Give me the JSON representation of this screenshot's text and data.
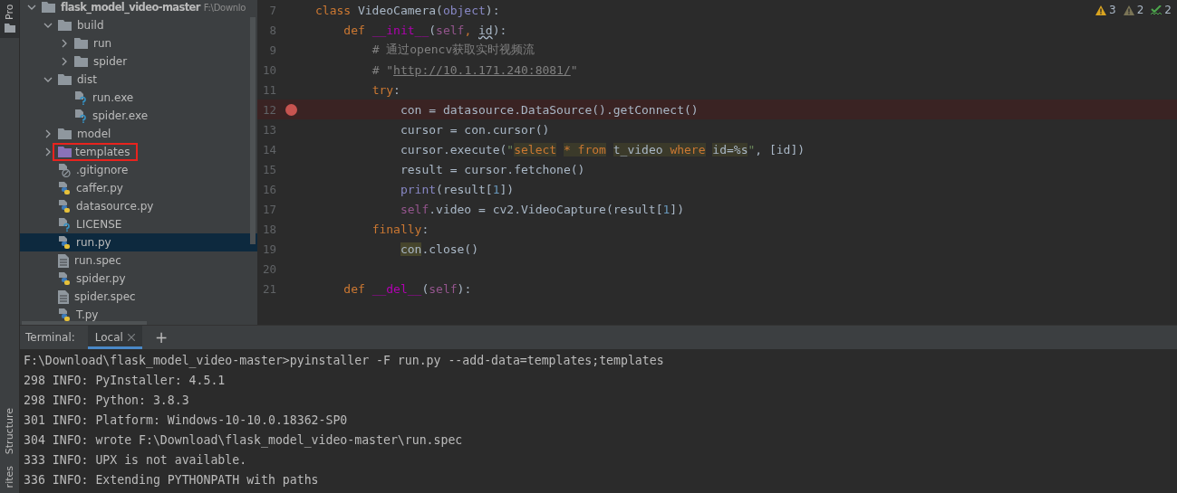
{
  "tool_strip": {
    "top": [
      {
        "label": "Pro",
        "selected": true
      }
    ],
    "bottom": [
      {
        "label": "Structure",
        "selected": false
      },
      {
        "label": "rites",
        "selected": false
      }
    ]
  },
  "project_tree": {
    "items": [
      {
        "label": "flask_model_video-master",
        "hint": "F:\\Downlo",
        "kind": "folder",
        "expanded": true,
        "selected": false,
        "marked": false,
        "children": [
          {
            "label": "build",
            "kind": "folder",
            "expanded": true,
            "selected": false,
            "marked": false,
            "children": [
              {
                "label": "run",
                "kind": "folder",
                "expanded": false,
                "selected": false,
                "marked": false
              },
              {
                "label": "spider",
                "kind": "folder",
                "expanded": false,
                "selected": false,
                "marked": false
              }
            ]
          },
          {
            "label": "dist",
            "kind": "folder",
            "expanded": true,
            "selected": false,
            "marked": false,
            "children": [
              {
                "label": "run.exe",
                "kind": "unknown",
                "selected": false,
                "marked": false
              },
              {
                "label": "spider.exe",
                "kind": "unknown",
                "selected": false,
                "marked": false
              }
            ]
          },
          {
            "label": "model",
            "kind": "folder",
            "expanded": false,
            "selected": false,
            "marked": false
          },
          {
            "label": "templates",
            "kind": "template-folder",
            "expanded": false,
            "selected": false,
            "marked": true
          },
          {
            "label": ".gitignore",
            "kind": "ignored",
            "selected": false,
            "marked": false
          },
          {
            "label": "caffer.py",
            "kind": "python",
            "selected": false,
            "marked": false
          },
          {
            "label": "datasource.py",
            "kind": "python",
            "selected": false,
            "marked": false
          },
          {
            "label": "LICENSE",
            "kind": "unknown",
            "selected": false,
            "marked": false
          },
          {
            "label": "run.py",
            "kind": "python",
            "selected": true,
            "marked": false
          },
          {
            "label": "run.spec",
            "kind": "text",
            "selected": false,
            "marked": false
          },
          {
            "label": "spider.py",
            "kind": "python",
            "selected": false,
            "marked": false
          },
          {
            "label": "spider.spec",
            "kind": "text",
            "selected": false,
            "marked": false
          },
          {
            "label": "T.py",
            "kind": "python",
            "selected": false,
            "marked": false
          }
        ]
      }
    ]
  },
  "inspections": [
    {
      "kind": "warning",
      "count": "3"
    },
    {
      "kind": "weak-warning",
      "count": "2"
    },
    {
      "kind": "typo",
      "count": "2"
    }
  ],
  "editor": {
    "lines": [
      {
        "number": "7",
        "breakpoint": false,
        "tokens": [
          {
            "text": "class",
            "kind": "kw"
          },
          {
            "text": " VideoCamera(",
            "kind": "plain"
          },
          {
            "text": "object",
            "kind": "builtin"
          },
          {
            "text": "):",
            "kind": "plain"
          }
        ]
      },
      {
        "number": "8",
        "breakpoint": false,
        "tokens": [
          {
            "text": "    def ",
            "kind": "kw"
          },
          {
            "text": "__init__",
            "kind": "magic"
          },
          {
            "text": "(",
            "kind": "plain"
          },
          {
            "text": "self",
            "kind": "self"
          },
          {
            "text": ", ",
            "kind": "kw"
          },
          {
            "text": "id",
            "kind": "warn"
          },
          {
            "text": "):",
            "kind": "plain"
          }
        ]
      },
      {
        "number": "9",
        "breakpoint": false,
        "tokens": [
          {
            "text": "        # 通过opencv获取实时视频流",
            "kind": "comment"
          }
        ]
      },
      {
        "number": "10",
        "breakpoint": false,
        "tokens": [
          {
            "text": "        # \"",
            "kind": "comment"
          },
          {
            "text": "http://10.1.171.240:8081/",
            "kind": "link"
          },
          {
            "text": "\"",
            "kind": "comment"
          }
        ]
      },
      {
        "number": "11",
        "breakpoint": false,
        "tokens": [
          {
            "text": "        try",
            "kind": "kw"
          },
          {
            "text": ":",
            "kind": "plain"
          }
        ]
      },
      {
        "number": "12",
        "breakpoint": true,
        "tokens": [
          {
            "text": "            con = datasource.DataSource().getConnect()",
            "kind": "plain"
          }
        ]
      },
      {
        "number": "13",
        "breakpoint": false,
        "tokens": [
          {
            "text": "            cursor = con.cursor()",
            "kind": "plain"
          }
        ]
      },
      {
        "number": "14",
        "breakpoint": false,
        "tokens": [
          {
            "text": "            cursor.execute(",
            "kind": "plain"
          },
          {
            "text": "\"",
            "kind": "str"
          },
          {
            "text": "select",
            "kind": "sql-kw"
          },
          {
            "text": " * ",
            "kind": "sql-kw"
          },
          {
            "text": "from",
            "kind": "sql-kw"
          },
          {
            "text": " t_video ",
            "kind": "sql"
          },
          {
            "text": "where",
            "kind": "sql-kw"
          },
          {
            "text": " id=%s",
            "kind": "sql"
          },
          {
            "text": "\"",
            "kind": "str"
          },
          {
            "text": ", [id])",
            "kind": "plain"
          }
        ]
      },
      {
        "number": "15",
        "breakpoint": false,
        "tokens": [
          {
            "text": "            result = cursor.fetchone()",
            "kind": "plain"
          }
        ]
      },
      {
        "number": "16",
        "breakpoint": false,
        "tokens": [
          {
            "text": "            print",
            "kind": "builtin"
          },
          {
            "text": "(result[",
            "kind": "plain"
          },
          {
            "text": "1",
            "kind": "num"
          },
          {
            "text": "])",
            "kind": "plain"
          }
        ]
      },
      {
        "number": "17",
        "breakpoint": false,
        "tokens": [
          {
            "text": "            self",
            "kind": "self"
          },
          {
            "text": ".video = cv2.VideoCapture(result[",
            "kind": "plain"
          },
          {
            "text": "1",
            "kind": "num"
          },
          {
            "text": "])",
            "kind": "plain"
          }
        ]
      },
      {
        "number": "18",
        "breakpoint": false,
        "tokens": [
          {
            "text": "        finally",
            "kind": "kw"
          },
          {
            "text": ":",
            "kind": "plain"
          }
        ]
      },
      {
        "number": "19",
        "breakpoint": false,
        "tokens": [
          {
            "text": "            con",
            "kind": "usage"
          },
          {
            "text": ".close()",
            "kind": "plain"
          }
        ]
      },
      {
        "number": "20",
        "breakpoint": false
      },
      {
        "number": "21",
        "breakpoint": false,
        "tokens": [
          {
            "text": "    def ",
            "kind": "kw"
          },
          {
            "text": "__del__",
            "kind": "magic"
          },
          {
            "text": "(",
            "kind": "plain"
          },
          {
            "text": "self",
            "kind": "self"
          },
          {
            "text": "):",
            "kind": "plain"
          }
        ]
      }
    ]
  },
  "terminal": {
    "title": "Terminal:",
    "tabs": [
      {
        "label": "Local",
        "selected": true
      }
    ],
    "add_label": "+",
    "lines": [
      "F:\\Download\\flask_model_video-master>pyinstaller -F run.py --add-data=templates;templates",
      "298 INFO: PyInstaller: 4.5.1",
      "298 INFO: Python: 3.8.3",
      "301 INFO: Platform: Windows-10-10.0.18362-SP0",
      "304 INFO: wrote F:\\Download\\flask_model_video-master\\run.spec",
      "333 INFO: UPX is not available.",
      "336 INFO: Extending PYTHONPATH with paths"
    ]
  }
}
